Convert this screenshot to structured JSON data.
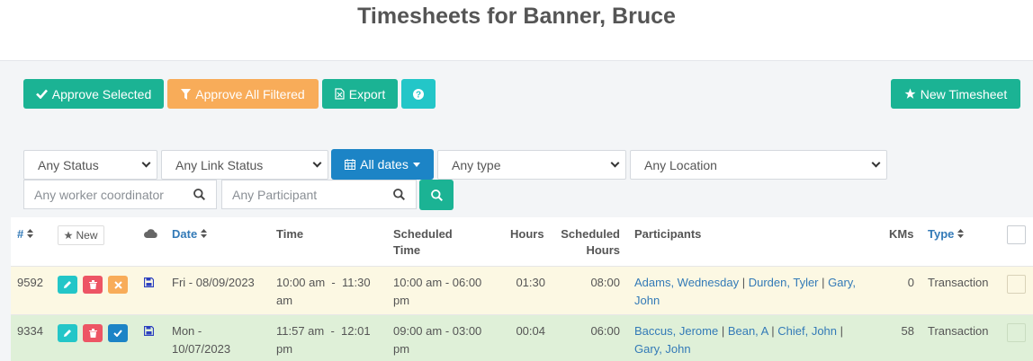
{
  "page": {
    "title": "Timesheets for Banner, Bruce"
  },
  "toolbar": {
    "approve_selected": "Approve Selected",
    "approve_all_filtered": "Approve All Filtered",
    "export": "Export",
    "new_timesheet": "New Timesheet"
  },
  "filters": {
    "status": "Any Status",
    "link_status": "Any Link Status",
    "dates": "All dates",
    "type": "Any type",
    "location": "Any Location",
    "worker_coordinator_placeholder": "Any worker coordinator",
    "participant_placeholder": "Any Participant"
  },
  "table": {
    "headers": {
      "id": "#",
      "new": "New",
      "date": "Date",
      "time": "Time",
      "scheduled_time_1": "Scheduled",
      "scheduled_time_2": "Time",
      "hours": "Hours",
      "scheduled_hours_1": "Scheduled",
      "scheduled_hours_2": "Hours",
      "participants": "Participants",
      "kms": "KMs",
      "type": "Type"
    },
    "rows": [
      {
        "id": "9592",
        "date_1": "Fri - 08/09/2023",
        "date_2": "",
        "time_1": "10:00 am  -  11:30",
        "time_2": "am",
        "sched_1": "10:00 am - 06:00",
        "sched_2": "pm",
        "hours": "01:30",
        "sched_hours": "08:00",
        "participants": [
          "Adams, Wednesday",
          "Durden, Tyler",
          "Gary,",
          "John"
        ],
        "kms": "0",
        "type": "Transaction",
        "status": "pending"
      },
      {
        "id": "9334",
        "date_1": "Mon -",
        "date_2": "10/07/2023",
        "time_1": "11:57 am  -  12:01",
        "time_2": "pm",
        "sched_1": "09:00 am - 03:00",
        "sched_2": "pm",
        "hours": "00:04",
        "sched_hours": "06:00",
        "participants": [
          "Baccus, Jerome",
          "Bean, A",
          "Chief, John",
          "Gary, John"
        ],
        "kms": "58",
        "type": "Transaction",
        "status": "approved"
      }
    ]
  },
  "colors": {
    "teal": "#1bb394",
    "orange": "#f8ac59",
    "cyan": "#23c6c8",
    "blue": "#1c84c6",
    "link": "#337ab7",
    "pending_row": "#fcf8e3",
    "approved_row": "#dff0d8"
  }
}
